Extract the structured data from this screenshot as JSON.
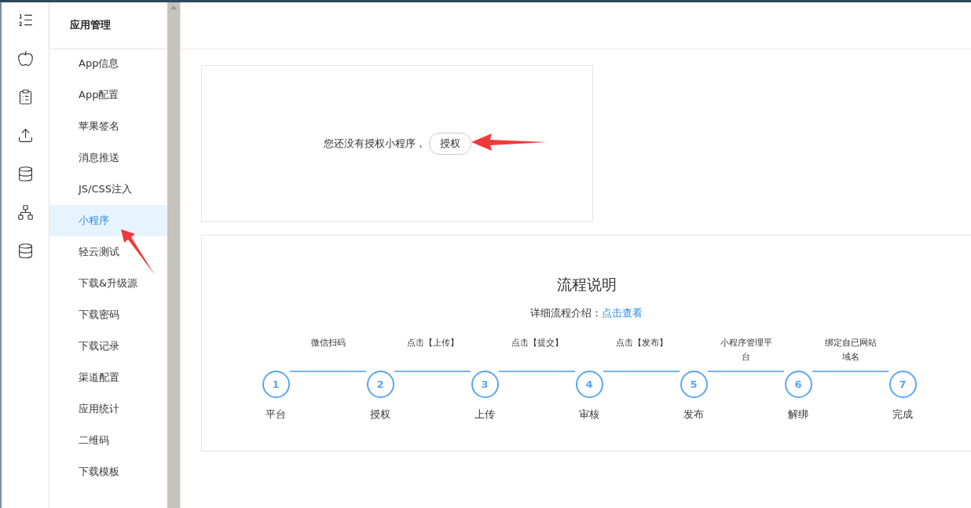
{
  "rail": {
    "icons": [
      {
        "kind": "list"
      },
      {
        "kind": "apple"
      },
      {
        "kind": "clipboard"
      },
      {
        "kind": "upload"
      },
      {
        "kind": "database"
      },
      {
        "kind": "network"
      },
      {
        "kind": "database"
      }
    ]
  },
  "menu": {
    "title": "应用管理",
    "items": [
      {
        "label": "App信息",
        "selected": false
      },
      {
        "label": "App配置",
        "selected": false
      },
      {
        "label": "苹果签名",
        "selected": false
      },
      {
        "label": "消息推送",
        "selected": false
      },
      {
        "label": "JS/CSS注入",
        "selected": false
      },
      {
        "label": "小程序",
        "selected": true
      },
      {
        "label": "轻云测试",
        "selected": false
      },
      {
        "label": "下载&升级源",
        "selected": false
      },
      {
        "label": "下载密码",
        "selected": false
      },
      {
        "label": "下载记录",
        "selected": false
      },
      {
        "label": "渠道配置",
        "selected": false
      },
      {
        "label": "应用统计",
        "selected": false
      },
      {
        "label": "二维码",
        "selected": false
      },
      {
        "label": "下载模板",
        "selected": false
      }
    ]
  },
  "auth_card": {
    "message": "您还没有授权小程序，",
    "button": "授权"
  },
  "process": {
    "title": "流程说明",
    "intro": "详细流程介绍：",
    "link": "点击查看",
    "steps": [
      {
        "number": "1",
        "label": "平台"
      },
      {
        "number": "2",
        "label": "授权"
      },
      {
        "number": "3",
        "label": "上传"
      },
      {
        "number": "4",
        "label": "审核"
      },
      {
        "number": "5",
        "label": "发布"
      },
      {
        "number": "6",
        "label": "解绑"
      },
      {
        "number": "7",
        "label": "完成"
      }
    ],
    "connectors": [
      "微信扫码",
      "点击【上传】",
      "点击【提交】",
      "点击【发布】",
      "小程序管理平台",
      "绑定自已网站域名"
    ]
  }
}
